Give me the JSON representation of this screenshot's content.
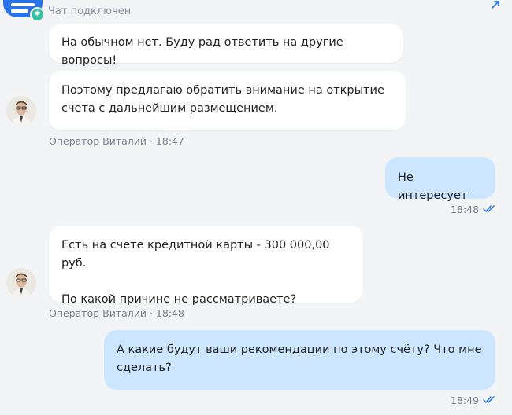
{
  "header": {
    "status": "Чат подключен"
  },
  "messages": [
    {
      "from": "operator",
      "text": "На обычном нет. Буду рад ответить на другие вопросы!"
    },
    {
      "from": "operator",
      "text": "Поэтому предлагаю обратить внимание на открытие счета с дальнейшим размещением.",
      "meta": "Оператор Виталий · 18:47"
    },
    {
      "from": "user",
      "text": "Не интересует",
      "time": "18:48"
    },
    {
      "from": "operator",
      "line1": "Есть на счете кредитной карты - 300 000,00 руб.",
      "line2": "По какой причине не рассматриваете?",
      "meta": "Оператор Виталий · 18:48"
    },
    {
      "from": "user",
      "text": "А какие будут ваши рекомендации по этому счёту? Что мне сделать?",
      "time": "18:49"
    }
  ],
  "colors": {
    "background": "#f3f4f6",
    "operator_bubble": "#ffffff",
    "user_bubble": "#cce6ff",
    "accent": "#2a73e6",
    "read_check": "#2a73e6"
  },
  "icons": [
    "logo-icon",
    "online-badge-icon",
    "expand-icon",
    "operator-avatar",
    "read-check-icon"
  ]
}
